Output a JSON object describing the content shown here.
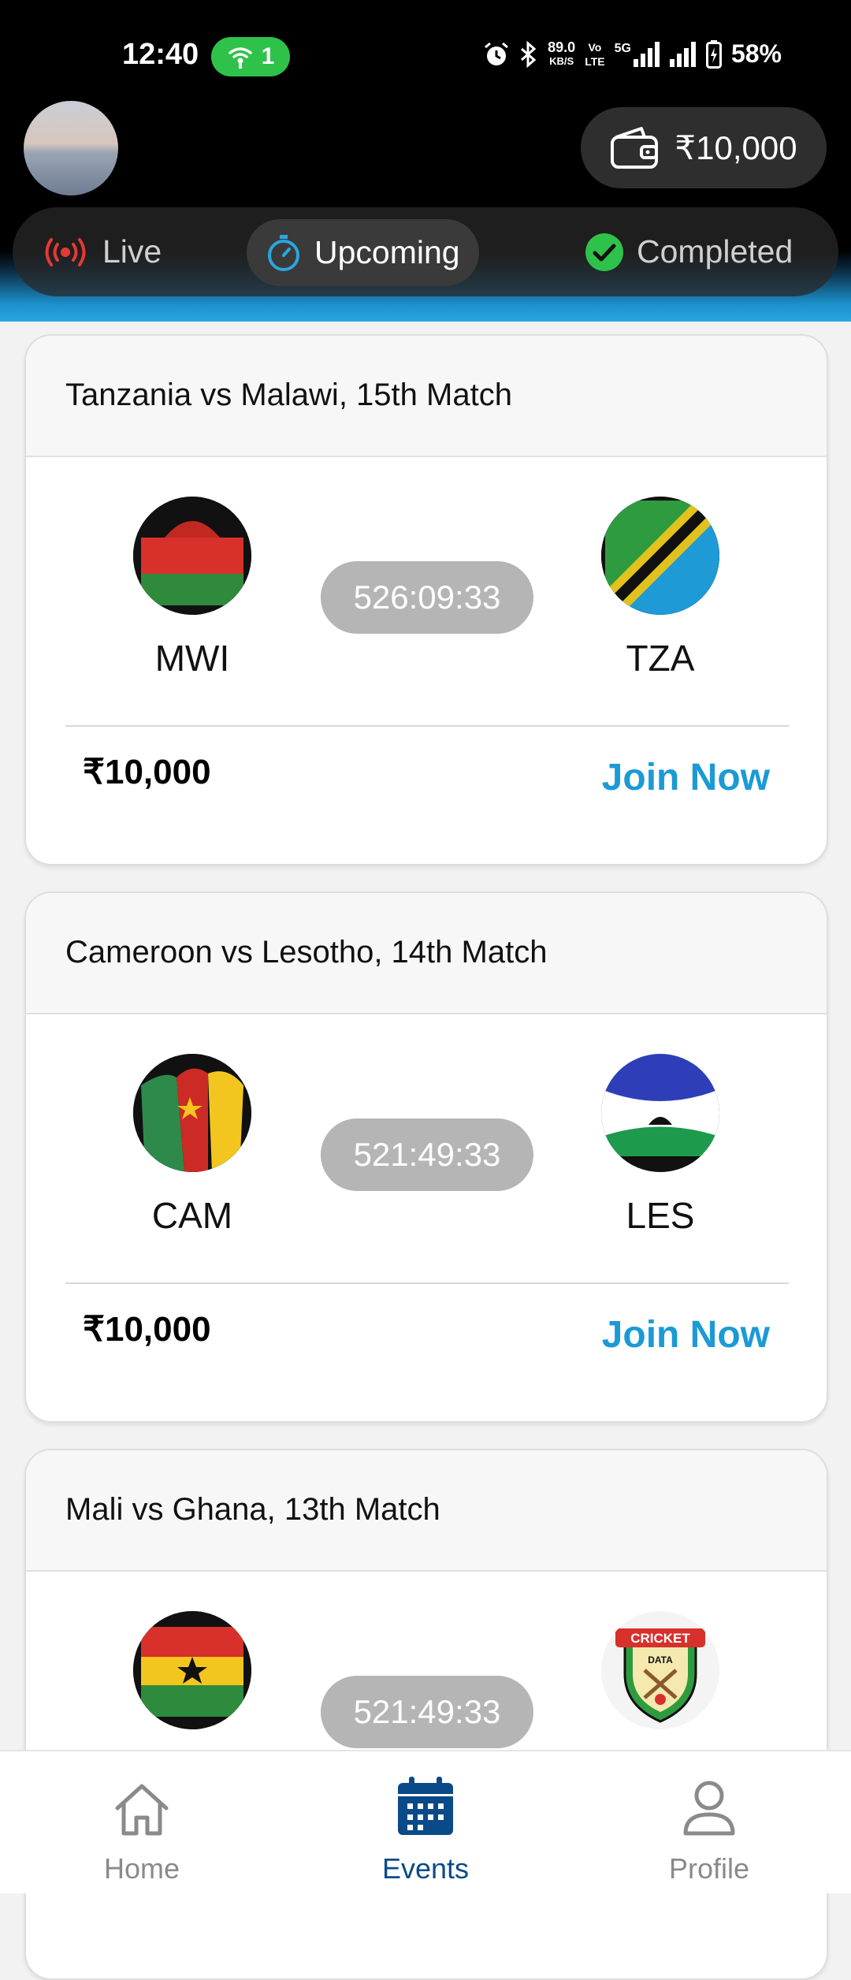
{
  "status_bar": {
    "time": "12:40",
    "hotspot_count": "1",
    "net_speed": "89.0",
    "net_unit": "KB/S",
    "volte_top": "Vo",
    "volte_bottom": "LTE",
    "network": "5G",
    "battery": "58%"
  },
  "header": {
    "wallet_balance": "₹10,000"
  },
  "tabs": [
    {
      "label": "Live",
      "icon": "live-broadcast-icon",
      "color": "#e53935"
    },
    {
      "label": "Upcoming",
      "icon": "stopwatch-icon",
      "color": "#2aa6de",
      "selected": true
    },
    {
      "label": "Completed",
      "icon": "check-circle-icon",
      "color": "#2fc24a"
    }
  ],
  "matches": [
    {
      "title": "Tanzania vs Malawi, 15th Match",
      "left_team": "MWI",
      "right_team": "TZA",
      "timer": "526:09:33",
      "prize": "₹10,000",
      "action": "Join Now"
    },
    {
      "title": "Cameroon vs Lesotho, 14th Match",
      "left_team": "CAM",
      "right_team": "LES",
      "timer": "521:49:33",
      "prize": "₹10,000",
      "action": "Join Now"
    },
    {
      "title": "Mali vs Ghana, 13th Match",
      "timer": "521:49:33",
      "right_logo_text_top": "CRICKET",
      "right_logo_text_bottom": "DATA"
    }
  ],
  "bottom_nav": [
    {
      "label": "Home",
      "icon": "home-icon"
    },
    {
      "label": "Events",
      "icon": "calendar-icon",
      "selected": true
    },
    {
      "label": "Profile",
      "icon": "user-icon"
    }
  ],
  "colors": {
    "accent": "#1b9ad6",
    "nav_active": "#0b4a88",
    "timer_bg": "#b5b5b5"
  }
}
